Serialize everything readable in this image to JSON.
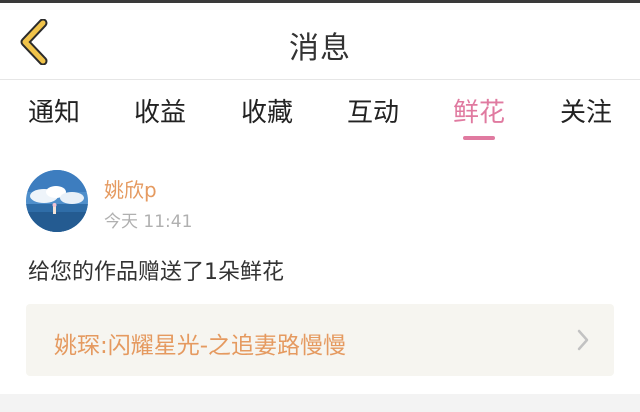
{
  "header": {
    "title": "消息"
  },
  "tabs": [
    {
      "label": "通知",
      "active": false
    },
    {
      "label": "收益",
      "active": false
    },
    {
      "label": "收藏",
      "active": false
    },
    {
      "label": "互动",
      "active": false
    },
    {
      "label": "鲜花",
      "active": true
    },
    {
      "label": "关注",
      "active": false
    }
  ],
  "notification": {
    "username": "姚欣p",
    "time": "今天 11:41",
    "message": "给您的作品赠送了1朵鲜花",
    "work_title": "姚琛:闪耀星光-之追妻路慢慢"
  },
  "colors": {
    "accent_pink": "#e07aa0",
    "accent_orange": "#e59a60",
    "back_arrow": "#f0c34a",
    "card_bg": "#f6f5f0"
  },
  "icons": {
    "back": "chevron-left-icon",
    "card_arrow": "chevron-right-icon"
  }
}
